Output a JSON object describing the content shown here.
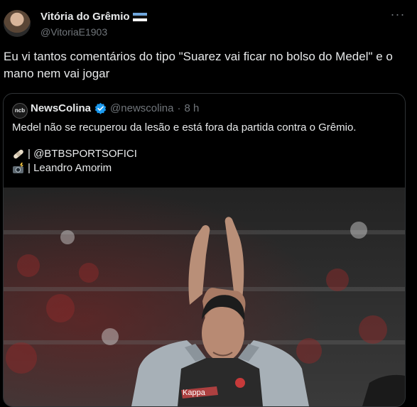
{
  "author": {
    "display_name": "Vitória do Grêmio",
    "handle": "@VitoriaE1903"
  },
  "tweet": {
    "text": "Eu vi tantos comentários do tipo \"Suarez vai ficar no bolso do Medel\" e o mano nem vai jogar"
  },
  "quote": {
    "avatar_text": "ncb",
    "name": "NewsColina",
    "handle": "@newscolina",
    "separator": "·",
    "time": "8 h",
    "text": "Medel não se recuperou da lesão e está fora da partida contra o Grêmio.",
    "credit_1": "| @BTBSPORTSOFICI",
    "credit_2": "| Leandro Amorim",
    "image_brand_text": "Kappa"
  },
  "colors": {
    "background": "#000000",
    "text": "#e7e9ea",
    "secondary": "#71767b",
    "verified": "#1d9bf0",
    "border": "#2f3336"
  },
  "icons": {
    "more": "more-icon",
    "verified": "verified-icon",
    "flag": "flag-icon",
    "bandage": "bandage-icon",
    "camera": "camera-flash-icon"
  }
}
